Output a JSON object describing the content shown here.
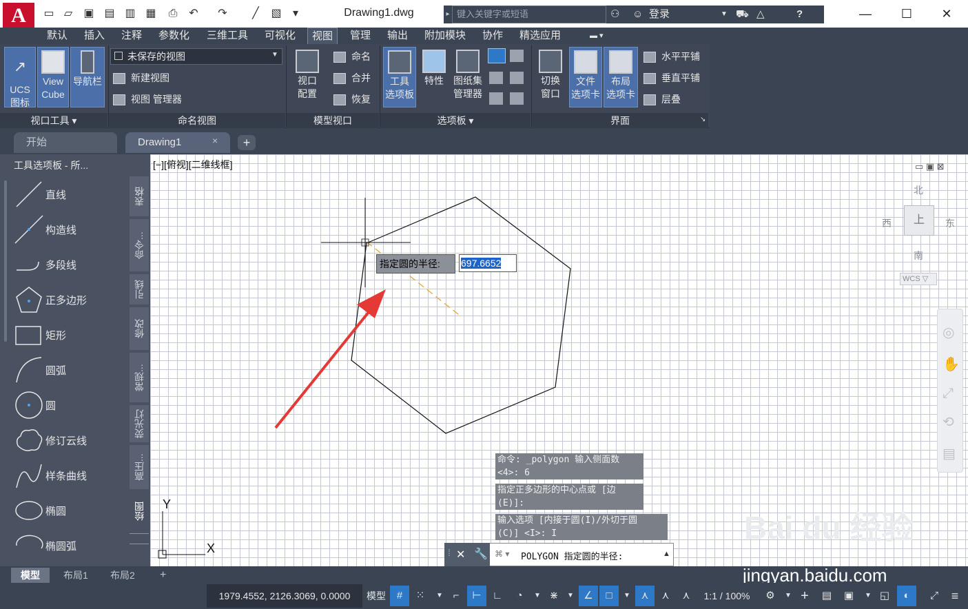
{
  "app": {
    "logo": "A",
    "doc_title": "Drawing1.dwg"
  },
  "header": {
    "search_placeholder": "键入关键字或短语",
    "login": "登录"
  },
  "menus": [
    "默认",
    "插入",
    "注释",
    "参数化",
    "三维工具",
    "可视化",
    "视图",
    "管理",
    "输出",
    "附加模块",
    "协作",
    "精选应用"
  ],
  "ribbon": {
    "viewport_tools": {
      "ucs": [
        "UCS",
        "图标"
      ],
      "viewcube": [
        "View",
        "Cube"
      ],
      "navbar": "导航栏",
      "label": "视口工具 ▾"
    },
    "named_views": {
      "dropdown": "未保存的视图",
      "new_view": "新建视图",
      "view_manager": "视图 管理器",
      "label": "命名视图"
    },
    "model_viewports": {
      "config": [
        "视口",
        "配置"
      ],
      "name": "命名",
      "join": "合并",
      "restore": "恢复",
      "label": "模型视口"
    },
    "palettes": {
      "tool_palettes": [
        "工具",
        "选项板"
      ],
      "properties": "特性",
      "sheet_set": [
        "图纸集",
        "管理器"
      ],
      "label": "选项板 ▾"
    },
    "interface": {
      "switch_window": [
        "切换",
        "窗口"
      ],
      "file_tabs": [
        "文件",
        "选项卡"
      ],
      "layout_tabs": [
        "布局",
        "选项卡"
      ],
      "tile_h": "水平平铺",
      "tile_v": "垂直平铺",
      "cascade": "层叠",
      "label": "界面"
    }
  },
  "file_tabs": {
    "start": "开始",
    "drawing": "Drawing1",
    "close": "×",
    "plus": "+"
  },
  "palette": {
    "title": "工具选项板 - 所...",
    "items": [
      "直线",
      "构造线",
      "多段线",
      "正多边形",
      "矩形",
      "圆弧",
      "圆",
      "修订云线",
      "样条曲线",
      "椭圆",
      "椭圆弧"
    ],
    "vtabs": [
      "表格",
      "命令...",
      "引线",
      "修改",
      "常规...",
      "荧光灯",
      "高压...",
      "绘图"
    ]
  },
  "viewport": {
    "label": "[−][俯视][二维线框]",
    "tooltip_label": "指定圆的半径:",
    "tooltip_value": "697.6652"
  },
  "viewcube": {
    "north": "北",
    "south": "南",
    "east": "东",
    "west": "西",
    "top": "上",
    "wcs": "WCS ▽"
  },
  "ucs_axes": {
    "x": "X",
    "y": "Y"
  },
  "history": [
    "命令: _polygon 输入侧面数\n<4>: 6",
    "指定正多边形的中心点或 [边\n(E)]:",
    "输入选项 [内接于圆(I)/外切于圆\n(C)] <I>: I"
  ],
  "command": {
    "prompt": "POLYGON 指定圆的半径:"
  },
  "layouts": {
    "model": "模型",
    "layout1": "布局1",
    "layout2": "布局2",
    "plus": "+"
  },
  "status": {
    "coords": "1979.4552, 2126.3069, 0.0000",
    "model": "模型",
    "scale": "1:1 / 100%"
  },
  "watermark": {
    "main": "Bai du 经验",
    "url": "jingyan.baidu.com"
  },
  "colors": {
    "accent": "#2d79c7",
    "arrow": "#e53935",
    "brand": "#c8102e"
  }
}
